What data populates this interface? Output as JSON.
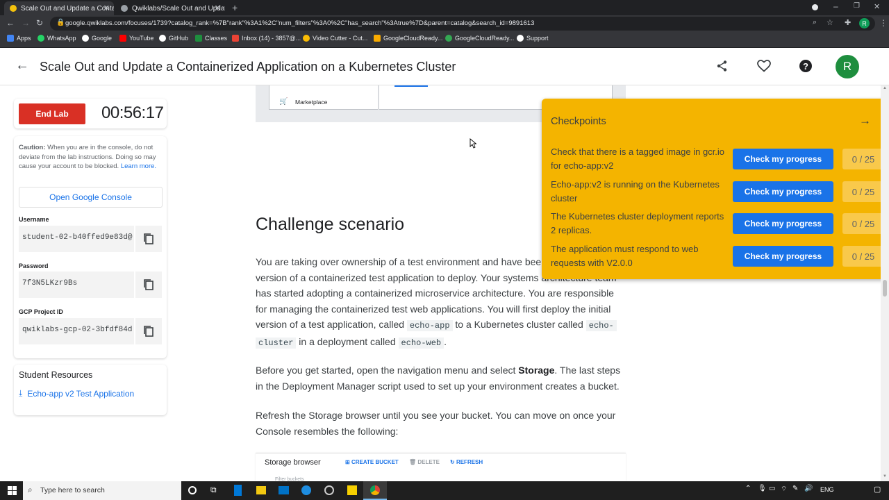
{
  "browser": {
    "tabs": [
      {
        "title": "Scale Out and Update a Containe",
        "active": true
      },
      {
        "title": "Qwiklabs/Scale Out and Update",
        "active": false
      }
    ],
    "url": "google.qwiklabs.com/focuses/1739?catalog_rank=%7B\"rank\"%3A1%2C\"num_filters\"%3A0%2C\"has_search\"%3Atrue%7D&parent=catalog&search_id=9891613",
    "profile_initial": "R",
    "bookmarks": [
      "Apps",
      "WhatsApp",
      "Google",
      "YouTube",
      "GitHub",
      "Classes",
      "Inbox (14) - 3857@...",
      "Video Cutter - Cut...",
      "GoogleCloudReady...",
      "GoogleCloudReady...",
      "Support"
    ]
  },
  "header": {
    "title": "Scale Out and Update a Containerized Application on a Kubernetes Cluster",
    "avatar_initial": "R"
  },
  "lab": {
    "end_label": "End Lab",
    "timer": "00:56:17",
    "caution_bold": "Caution:",
    "caution_text": " When you are in the console, do not deviate from the lab instructions. Doing so may cause your account to be blocked.",
    "learn_more": "Learn more.",
    "open_console": "Open Google Console",
    "username_label": "Username",
    "username": "student-02-b40ffed9e83d@",
    "password_label": "Password",
    "password": "7f3N5LKzr9Bs",
    "project_label": "GCP Project ID",
    "project": "qwiklabs-gcp-02-3bfdf84d"
  },
  "resources": {
    "heading": "Student Resources",
    "link": "Echo-app v2 Test Application"
  },
  "article": {
    "marketplace": "Marketplace",
    "heading": "Challenge scenario",
    "p1a": "You are taking over ownership of a test environment and have bee",
    "p1b": "version of a containerized test application to deploy. Your systems",
    "p1b2": "architecture team",
    "p1c": "has started adopting a containerized microservice architecture. You are responsible",
    "p1d": "for managing the containerized test web applications. You will first deploy the initial",
    "p1e1": "version of a test application, called ",
    "code1": "echo-app",
    "p1e2": " to a Kubernetes cluster called ",
    "code2a": "echo-",
    "code2b": "cluster",
    "p1f": " in a deployment called ",
    "code3": "echo-web",
    "p1g": ".",
    "p2a": "Before you get started, open the navigation menu and select ",
    "p2bold": "Storage",
    "p2b": ". The last steps",
    "p2c": "in the Deployment Manager script used to set up your environment creates a bucket.",
    "p3a": "Refresh the Storage browser until you see your bucket. You can move on once your",
    "p3b": "Console resembles the following:",
    "storage_title": "Storage browser",
    "create_bucket": "CREATE BUCKET",
    "delete": "DELETE",
    "refresh": "REFRESH",
    "filter": "Filter buckets"
  },
  "checkpoints": {
    "title": "Checkpoints",
    "button_label": "Check my progress",
    "items": [
      {
        "text": "Check that there is a tagged image in gcr.io for echo-app:v2",
        "score": "0 / 25"
      },
      {
        "text": "Echo-app:v2 is running on the Kubernetes cluster",
        "score": "0 / 25"
      },
      {
        "text": "The Kubernetes cluster deployment reports 2 replicas.",
        "score": "0 / 25"
      },
      {
        "text": "The application must respond to web requests with V2.0.0",
        "score": "0 / 25"
      }
    ]
  },
  "taskbar": {
    "search_placeholder": "Type here to search",
    "lang": "ENG"
  }
}
